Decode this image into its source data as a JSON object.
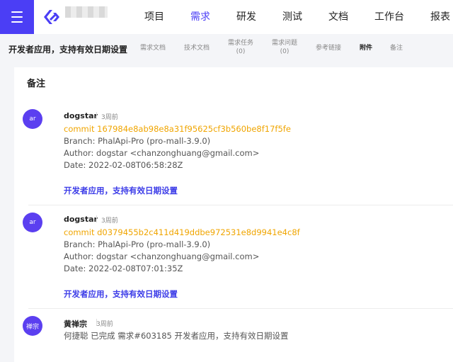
{
  "nav": {
    "items": [
      "项目",
      "需求",
      "研发",
      "测试",
      "文档",
      "工作台",
      "报表"
    ],
    "active": "需求"
  },
  "subheader": {
    "title": "开发者应用，支持有效日期设置",
    "tabs": [
      {
        "label": "需求文档",
        "count": ""
      },
      {
        "label": "技术文档",
        "count": ""
      },
      {
        "label": "需求任务",
        "count": "(0)"
      },
      {
        "label": "需求问题",
        "count": "(0)"
      },
      {
        "label": "参考链接",
        "count": ""
      },
      {
        "label": "附件",
        "count": ""
      },
      {
        "label": "备注",
        "count": ""
      }
    ]
  },
  "notes": {
    "title": "备注",
    "entries": [
      {
        "avatar": "ar",
        "author": "dogstar",
        "time": "3周前",
        "commit": "commit 167984e8ab98e8a31f95625cf3b560be8f17f5fe",
        "branch": "Branch: PhalApi-Pro (pro-mall-3.9.0)",
        "author_line": "Author: dogstar <chanzonghuang@gmail.com>",
        "date": "Date: 2022-02-08T06:58:28Z",
        "link": "开发者应用，支持有效日期设置"
      },
      {
        "avatar": "ar",
        "author": "dogstar",
        "time": "3周前",
        "commit": "commit d0379455b2c411d419ddbe972531e8d9941e4c8f",
        "branch": "Branch: PhalApi-Pro (pro-mall-3.9.0)",
        "author_line": "Author: dogstar <chanzonghuang@gmail.com>",
        "date": "Date: 2022-02-08T07:01:35Z",
        "link": "开发者应用，支持有效日期设置"
      },
      {
        "avatar": "禅宗",
        "author": "黄禅宗",
        "time": "3周前",
        "text": "何捷聪 已完成 需求#603185 开发者应用，支持有效日期设置"
      }
    ]
  },
  "colors": {
    "brand": "#4b3ef5",
    "commit": "#f0a500",
    "link": "#3d3de8"
  }
}
